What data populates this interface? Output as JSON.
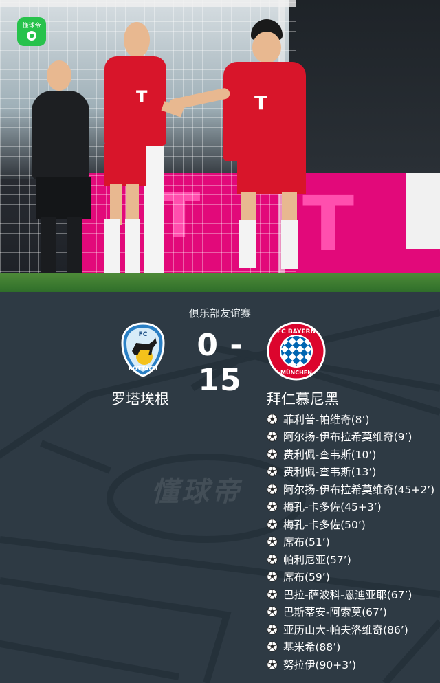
{
  "app": {
    "badge_label": "懂球帝",
    "watermark": "懂球帝"
  },
  "photo": {
    "board_brand": "T",
    "player_numbers": [
      "T",
      "T"
    ],
    "colors": {
      "board": "#e2097a",
      "kit": "#d8152a",
      "grass": "#3f7d32"
    }
  },
  "match": {
    "competition": "俱乐部友谊赛",
    "score": "0 - 15",
    "home": {
      "name": "罗塔埃根",
      "logo_text_top": "FC",
      "logo_text_bottom": "ROTTACH"
    },
    "away": {
      "name": "拜仁慕尼黑",
      "logo_text_top": "FC BAYERN",
      "logo_text_bottom": "MÜNCHEN"
    }
  },
  "scorers": [
    {
      "text": "菲利普-帕维奇(8’)"
    },
    {
      "text": "阿尔扬-伊布拉希莫维奇(9’)"
    },
    {
      "text": "费利佩-查韦斯(10’)"
    },
    {
      "text": "费利佩-查韦斯(13’)"
    },
    {
      "text": "阿尔扬-伊布拉希莫维奇(45+2’)"
    },
    {
      "text": "梅孔-卡多佐(45+3’)"
    },
    {
      "text": "梅孔-卡多佐(50’)"
    },
    {
      "text": "席布(51’)"
    },
    {
      "text": "帕利尼亚(57’)"
    },
    {
      "text": "席布(59’)"
    },
    {
      "text": "巴拉-萨波科-恩迪亚耶(67’)"
    },
    {
      "text": "巴斯蒂安-阿索莫(67’)"
    },
    {
      "text": "亚历山大-帕夫洛维奇(86’)"
    },
    {
      "text": "基米希(88’)"
    },
    {
      "text": "努拉伊(90+3’)"
    }
  ]
}
